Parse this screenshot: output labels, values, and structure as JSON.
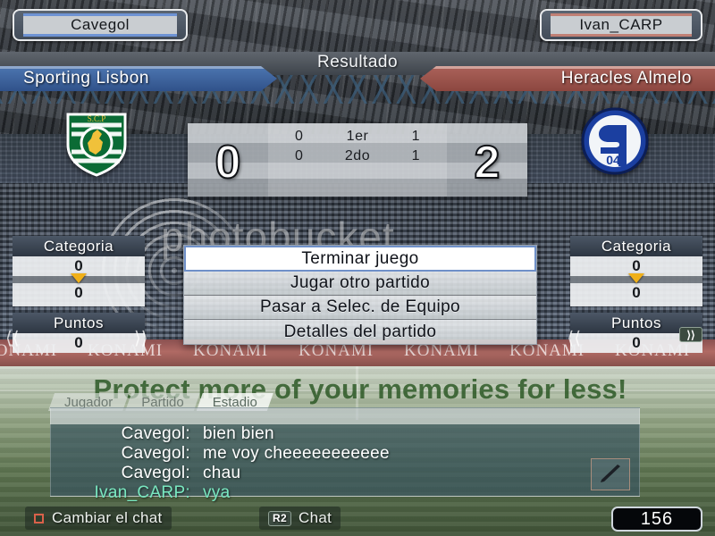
{
  "players": {
    "home": {
      "name": "Cavegol",
      "accent": "#6e93d4"
    },
    "away": {
      "name": "Ivan_CARP",
      "accent": "#c08075"
    }
  },
  "result_header": {
    "label": "Resultado",
    "home_team": "Sporting Lisbon",
    "away_team": "Heracles Almelo"
  },
  "crests": {
    "home_icon": "sporting-lisbon-crest-icon",
    "away_icon": "schalke-04-crest-icon"
  },
  "scoreboard": {
    "home_score": "0",
    "away_score": "2",
    "periods": [
      {
        "home": "0",
        "label": "1er",
        "away": "1"
      },
      {
        "home": "0",
        "label": "2do",
        "away": "1"
      }
    ]
  },
  "stats": {
    "home": {
      "categoria_label": "Categoria",
      "categoria_from": "0",
      "categoria_to": "0",
      "puntos_label": "Puntos",
      "puntos_value": "0"
    },
    "away": {
      "categoria_label": "Categoria",
      "categoria_from": "0",
      "categoria_to": "0",
      "puntos_label": "Puntos",
      "puntos_value": "0"
    }
  },
  "menu": {
    "items": [
      {
        "label": "Terminar juego",
        "selected": true
      },
      {
        "label": "Jugar otro partido",
        "selected": false
      },
      {
        "label": "Pasar a Selec. de Equipo",
        "selected": false
      },
      {
        "label": "Detalles del partido",
        "selected": false
      }
    ]
  },
  "chat": {
    "tabs": [
      {
        "label": "Jugador",
        "active": false
      },
      {
        "label": "Partido",
        "active": false
      },
      {
        "label": "Estadio",
        "active": true
      }
    ],
    "messages": [
      {
        "who": "Cavegol:",
        "msg": "bien bien",
        "color": "#ffffff"
      },
      {
        "who": "Cavegol:",
        "msg": "me voy cheeeeeeeeeee",
        "color": "#ffffff"
      },
      {
        "who": "Cavegol:",
        "msg": "chau",
        "color": "#ffffff"
      },
      {
        "who": "Ivan_CARP:",
        "msg": "vya",
        "color": "#79e8c0"
      }
    ],
    "compose_icon": "pencil-icon"
  },
  "bottom_bar": {
    "hint1_icon": "square-button-icon",
    "hint1_label": "Cambiar el chat",
    "hint2_key": "R2",
    "hint2_label": "Chat",
    "counter": "156"
  },
  "background": {
    "hoarding_text": "KONAMI",
    "watermark_main": "photobucket",
    "watermark_tagline": "Protect more of your memories for less!"
  }
}
